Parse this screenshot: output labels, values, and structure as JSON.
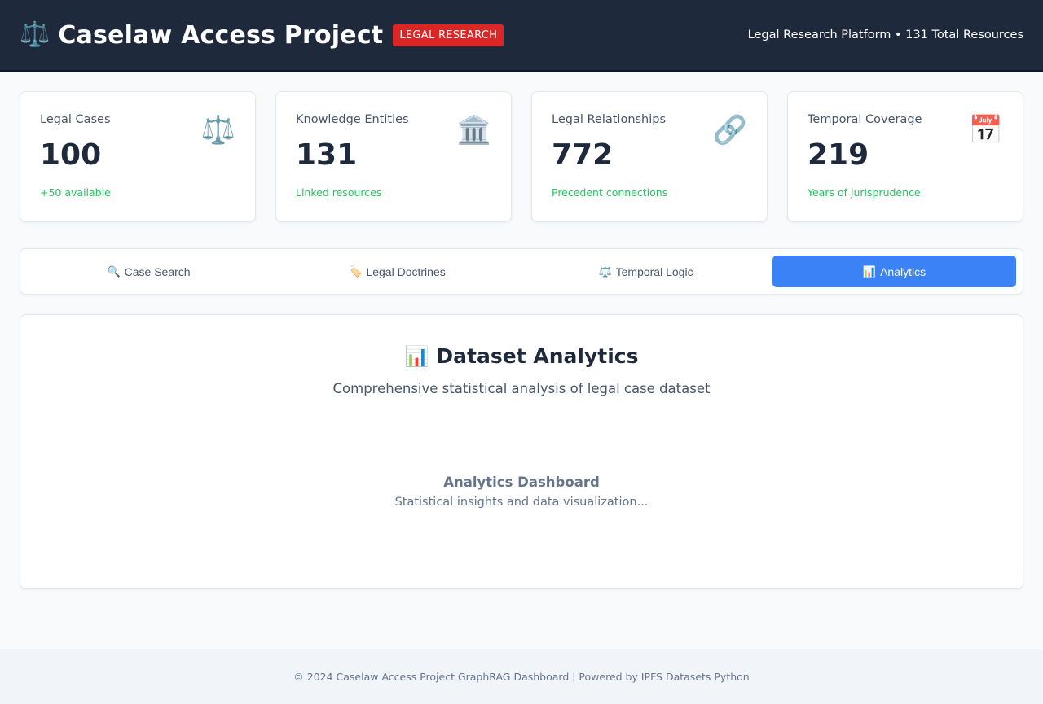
{
  "header": {
    "icon": "⚖️",
    "title": "Caselaw Access Project",
    "badge": "LEGAL RESEARCH",
    "meta": "Legal Research Platform • 131 Total Resources"
  },
  "stats": [
    {
      "label": "Legal Cases",
      "value": "100",
      "note": "+50 available",
      "icon": "⚖️",
      "icon_name": "scales-icon"
    },
    {
      "label": "Knowledge Entities",
      "value": "131",
      "note": "Linked resources",
      "icon": "🏛️",
      "icon_name": "courthouse-icon"
    },
    {
      "label": "Legal Relationships",
      "value": "772",
      "note": "Precedent connections",
      "icon": "🔗",
      "icon_name": "link-icon"
    },
    {
      "label": "Temporal Coverage",
      "value": "219",
      "note": "Years of jurisprudence",
      "icon": "📅",
      "icon_name": "calendar-icon"
    }
  ],
  "tabs": [
    {
      "icon": "🔍",
      "label": "Case Search",
      "active": false
    },
    {
      "icon": "🏷️",
      "label": "Legal Doctrines",
      "active": false
    },
    {
      "icon": "⚖️",
      "label": "Temporal Logic",
      "active": false
    },
    {
      "icon": "📊",
      "label": "Analytics",
      "active": true
    }
  ],
  "panel": {
    "icon": "📊",
    "title": "Dataset Analytics",
    "subtitle": "Comprehensive statistical analysis of legal case dataset",
    "placeholder_title": "Analytics Dashboard",
    "placeholder_text": "Statistical insights and data visualization..."
  },
  "footer": {
    "text": "© 2024 Caselaw Access Project GraphRAG Dashboard | Powered by IPFS Datasets Python"
  },
  "colors": {
    "header_bg": "#1e293b",
    "badge_bg": "#dc2626",
    "accent": "#3b82f6",
    "positive": "#22c55e"
  }
}
